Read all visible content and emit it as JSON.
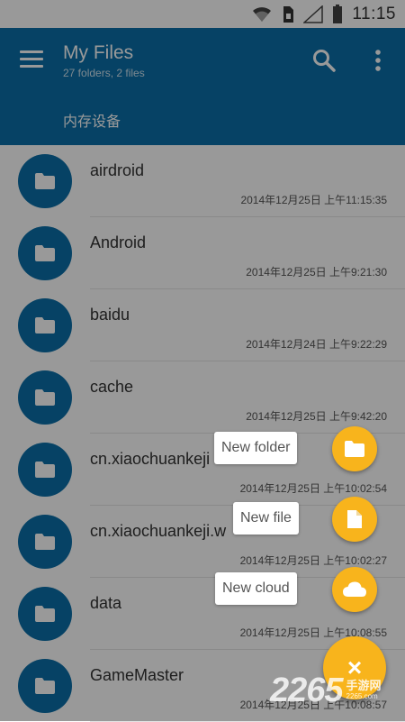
{
  "status_bar": {
    "time": "11:15"
  },
  "app_bar": {
    "title": "My Files",
    "subtitle": "27 folders, 2 files",
    "location": "内存设备"
  },
  "files": [
    {
      "name": "airdroid",
      "date": "2014年12月25日 上午11:15:35"
    },
    {
      "name": "Android",
      "date": "2014年12月25日 上午9:21:30"
    },
    {
      "name": "baidu",
      "date": "2014年12月24日 上午9:22:29"
    },
    {
      "name": "cache",
      "date": "2014年12月25日 上午9:42:20"
    },
    {
      "name": "cn.xiaochuankeji",
      "date": "2014年12月25日 上午10:02:54"
    },
    {
      "name": "cn.xiaochuankeji.w",
      "date": "2014年12月25日 上午10:02:27"
    },
    {
      "name": "data",
      "date": "2014年12月25日 上午10:08:55"
    },
    {
      "name": "GameMaster",
      "date": "2014年12月25日 上午10:08:57"
    }
  ],
  "fab_menu": {
    "new_folder": "New folder",
    "new_file": "New file",
    "new_cloud": "New cloud",
    "close_symbol": "×"
  },
  "watermark": {
    "number": "2265",
    "cn": "手游网",
    "en": "2265.com"
  },
  "colors": {
    "primary": "#0a6fa8",
    "accent": "#f8b41c"
  }
}
